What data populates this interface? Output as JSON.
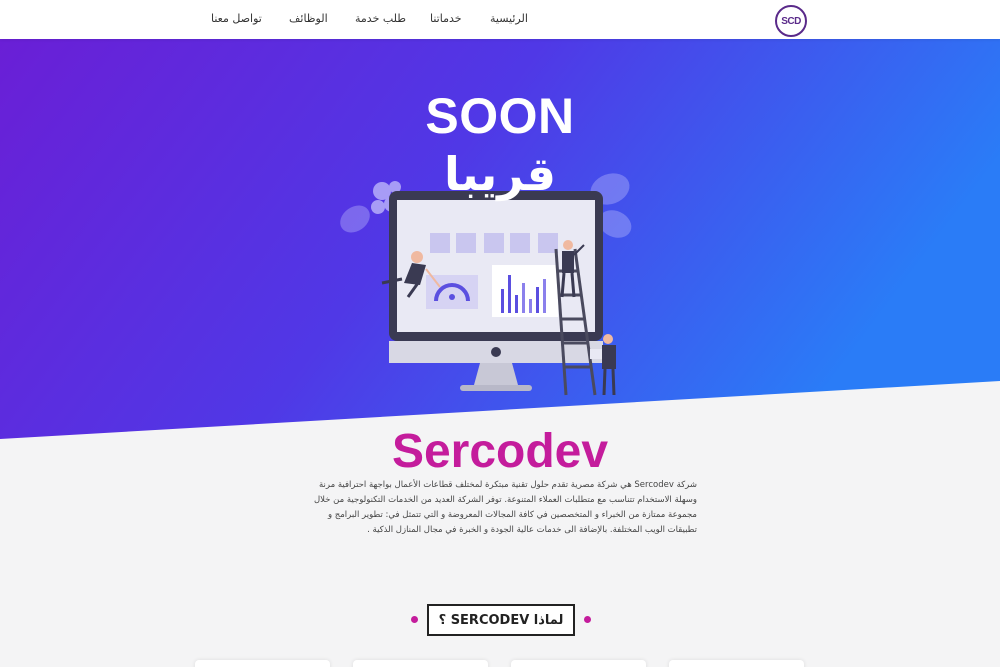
{
  "nav": {
    "items": [
      {
        "label": "الرئيسية"
      },
      {
        "label": "خدماتنا"
      },
      {
        "label": "طلب خدمة"
      },
      {
        "label": "الوظائف"
      },
      {
        "label": "تواصل معنا"
      }
    ],
    "logo_text": "SCD"
  },
  "hero": {
    "title_en": "SOON",
    "title_ar": "قريبا"
  },
  "about": {
    "brand": "Sercodev",
    "description": "شركة Sercodev هي شركة مصرية تقدم حلول تقنية مبتكرة لمختلف قطاعات الأعمال بواجهة احترافية مرنة وسهلة الاستخدام تتناسب مع متطلبات العملاء المتنوعة. توفر الشركة العديد من الخدمات التكنولوجية من خلال مجموعة ممتازة من الخبراء و المتخصصين في كافة المجالات المعروضة و التي تتمثل في: تطوير البرامج و تطبيقات الويب المختلفة. بالإضافة الى خدمات عالية الجودة و الخبرة في مجال المنازل الذكية ."
  },
  "why": {
    "label": "لماذا SERCODEV ؟"
  },
  "colors": {
    "accent": "#c41c9c",
    "hero_start": "#6a1fd6",
    "hero_end": "#2a7cf7"
  }
}
